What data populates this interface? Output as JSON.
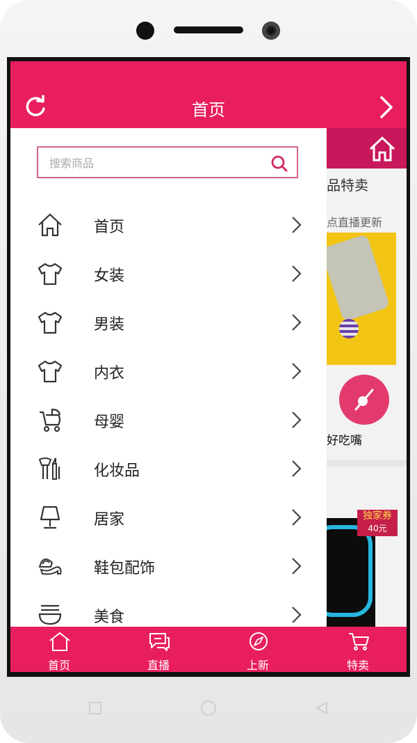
{
  "header": {
    "title": "首页"
  },
  "search": {
    "placeholder": "搜索商品"
  },
  "menu": [
    {
      "label": "首页",
      "icon": "home-icon"
    },
    {
      "label": "女装",
      "icon": "tshirt-icon"
    },
    {
      "label": "男装",
      "icon": "tshirt-icon"
    },
    {
      "label": "内衣",
      "icon": "tshirt-icon"
    },
    {
      "label": "母婴",
      "icon": "stroller-icon"
    },
    {
      "label": "化妆品",
      "icon": "cosmetics-icon"
    },
    {
      "label": "居家",
      "icon": "lamp-icon"
    },
    {
      "label": "鞋包配饰",
      "icon": "shoe-bag-icon"
    },
    {
      "label": "美食",
      "icon": "food-bowl-icon"
    }
  ],
  "background_page": {
    "section_title": "品特卖",
    "update_text": "点直播更新",
    "snack_label": "好吃嘴",
    "coupon_title": "独家券",
    "coupon_value": "40元"
  },
  "tabbar": [
    {
      "label": "首页",
      "icon": "home-icon"
    },
    {
      "label": "直播",
      "icon": "chat-icon"
    },
    {
      "label": "上新",
      "icon": "compass-icon"
    },
    {
      "label": "特卖",
      "icon": "cart-icon"
    }
  ],
  "colors": {
    "brand": "#e91e5f",
    "search_border": "#d46288"
  }
}
